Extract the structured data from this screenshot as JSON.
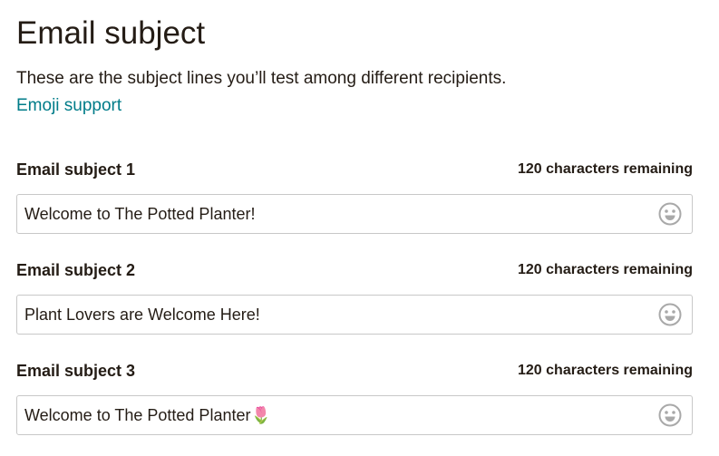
{
  "header": {
    "title": "Email subject",
    "description": "These are the subject lines you’ll test among different recipients.",
    "emoji_link": "Emoji support"
  },
  "fields": [
    {
      "label": "Email subject 1",
      "remaining": "120 characters remaining",
      "value": "Welcome to The Potted Planter!"
    },
    {
      "label": "Email subject 2",
      "remaining": "120 characters remaining",
      "value": "Plant Lovers are Welcome Here!"
    },
    {
      "label": "Email subject 3",
      "remaining": "120 characters remaining",
      "value": "Welcome to The Potted Planter🌷"
    }
  ],
  "icons": {
    "emoji_picker": "smiley-face-icon"
  },
  "colors": {
    "text": "#241c15",
    "link": "#007c89",
    "input_border": "#c8c8c8",
    "icon": "#a9a9a9"
  }
}
